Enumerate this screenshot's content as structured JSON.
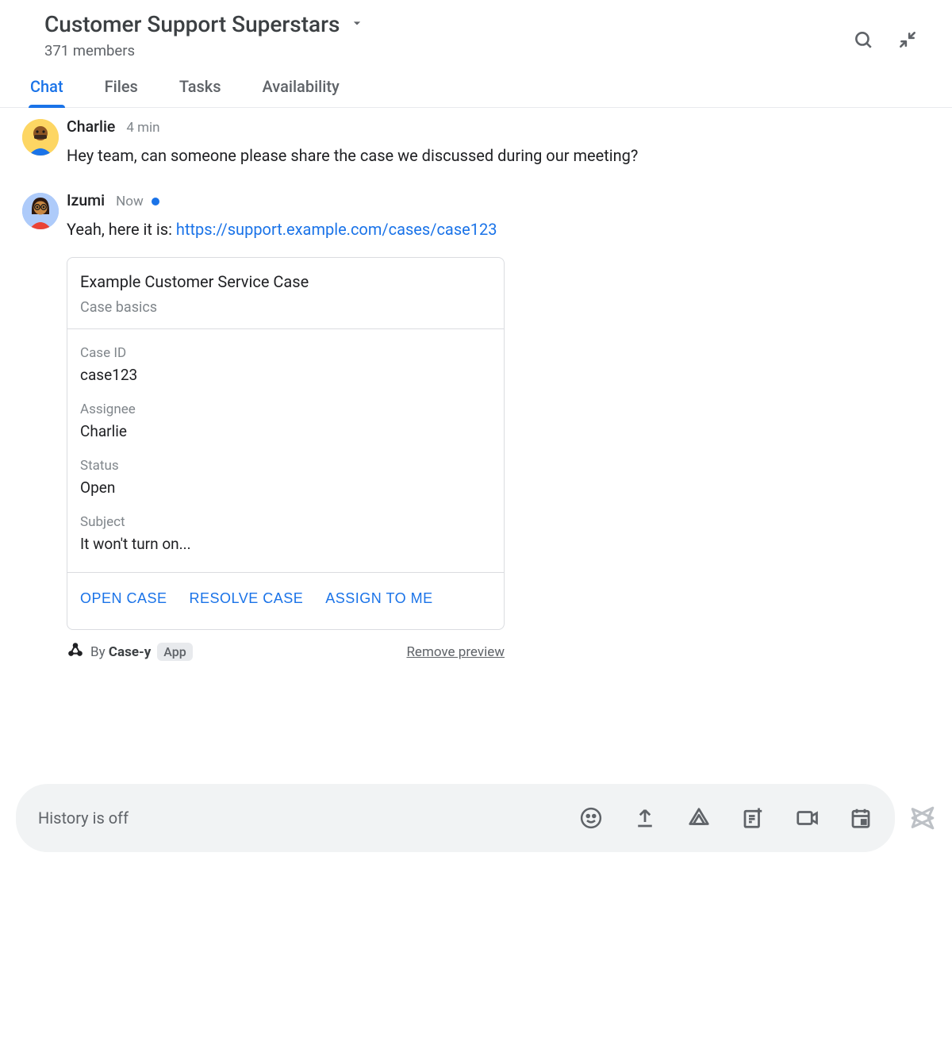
{
  "header": {
    "title": "Customer Support Superstars",
    "members_text": "371 members"
  },
  "tabs": [
    "Chat",
    "Files",
    "Tasks",
    "Availability"
  ],
  "active_tab_index": 0,
  "messages": [
    {
      "author": "Charlie",
      "time": "4 min",
      "online": false,
      "body_plain": "Hey team, can someone please share the case we discussed during our meeting?"
    },
    {
      "author": "Izumi",
      "time": "Now",
      "online": true,
      "body_prefix": "Yeah, here it is: ",
      "link_text": "https://support.example.com/cases/case123"
    }
  ],
  "card": {
    "title": "Example Customer Service Case",
    "subtitle": "Case basics",
    "fields": [
      {
        "label": "Case ID",
        "value": "case123"
      },
      {
        "label": "Assignee",
        "value": "Charlie"
      },
      {
        "label": "Status",
        "value": "Open"
      },
      {
        "label": "Subject",
        "value": "It won't turn on..."
      }
    ],
    "actions": [
      "OPEN CASE",
      "RESOLVE CASE",
      "ASSIGN TO ME"
    ]
  },
  "preview_footer": {
    "by_prefix": "By ",
    "app_name": "Case-y",
    "badge": "App",
    "remove_text": "Remove preview"
  },
  "composer": {
    "placeholder": "History is off"
  }
}
